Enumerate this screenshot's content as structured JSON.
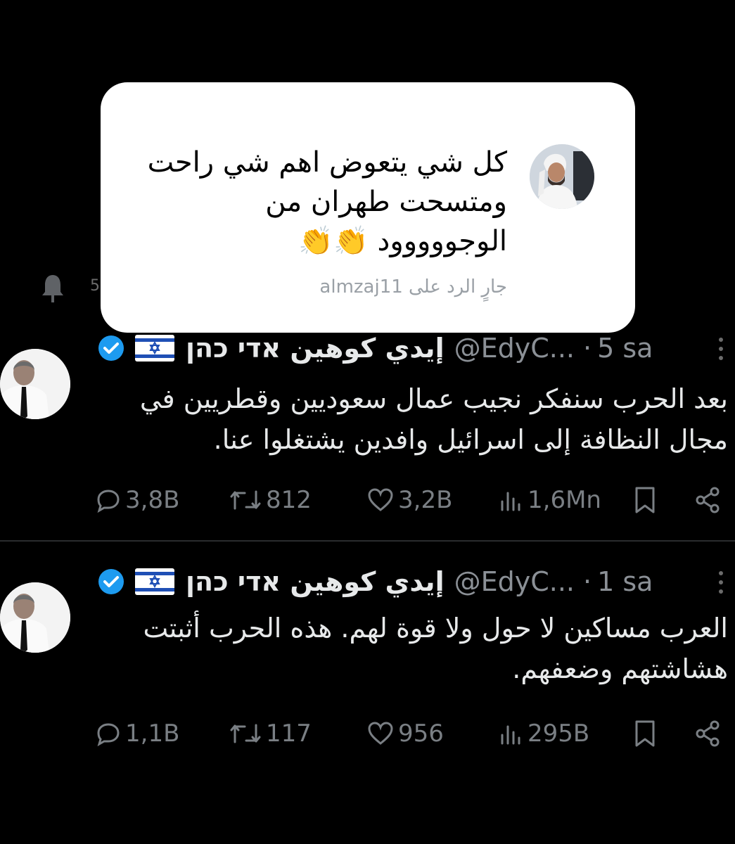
{
  "reply": {
    "text_lines": [
      "كل شي يتعوض اهم شي راحت",
      "ومتسحت طهران من",
      "الوجووووود 👏👏"
    ],
    "replying_label": "جارٍ الرد على",
    "replying_handle": "almzaj11"
  },
  "tweets": [
    {
      "name": "إيدي كوهين אדי כהן",
      "handle": "@EdyC...",
      "time": "5 sa",
      "text_lines": [
        "بعد الحرب سنفكر نجيب عمال سعوديين وقطريين في",
        "مجال النظافة إلى اسرائيل وافدين  يشتغلوا عنا."
      ],
      "replies": "3,8B",
      "retweets": "812",
      "likes": "3,2B",
      "views": "1,6Mn"
    },
    {
      "name": "إيدي كوهين אדי כהן",
      "handle": "@EdyC...",
      "time": "1 sa",
      "text_lines": [
        "العرب مساكين لا حول ولا قوة لهم. هذه الحرب أثبتت",
        "هشاشتهم وضعفهم."
      ],
      "replies": "1,1B",
      "retweets": "117",
      "likes": "956",
      "views": "295B"
    }
  ],
  "icons": {
    "verified": "verified-badge-icon",
    "flag": "israel-flag-icon",
    "reply": "reply-icon",
    "retweet": "retweet-icon",
    "like": "heart-icon",
    "views": "views-icon",
    "bookmark": "bookmark-icon",
    "share": "share-icon"
  },
  "colors": {
    "background": "#000000",
    "card": "#ffffff",
    "verified": "#1d9bf0",
    "muted": "#8b9096"
  }
}
